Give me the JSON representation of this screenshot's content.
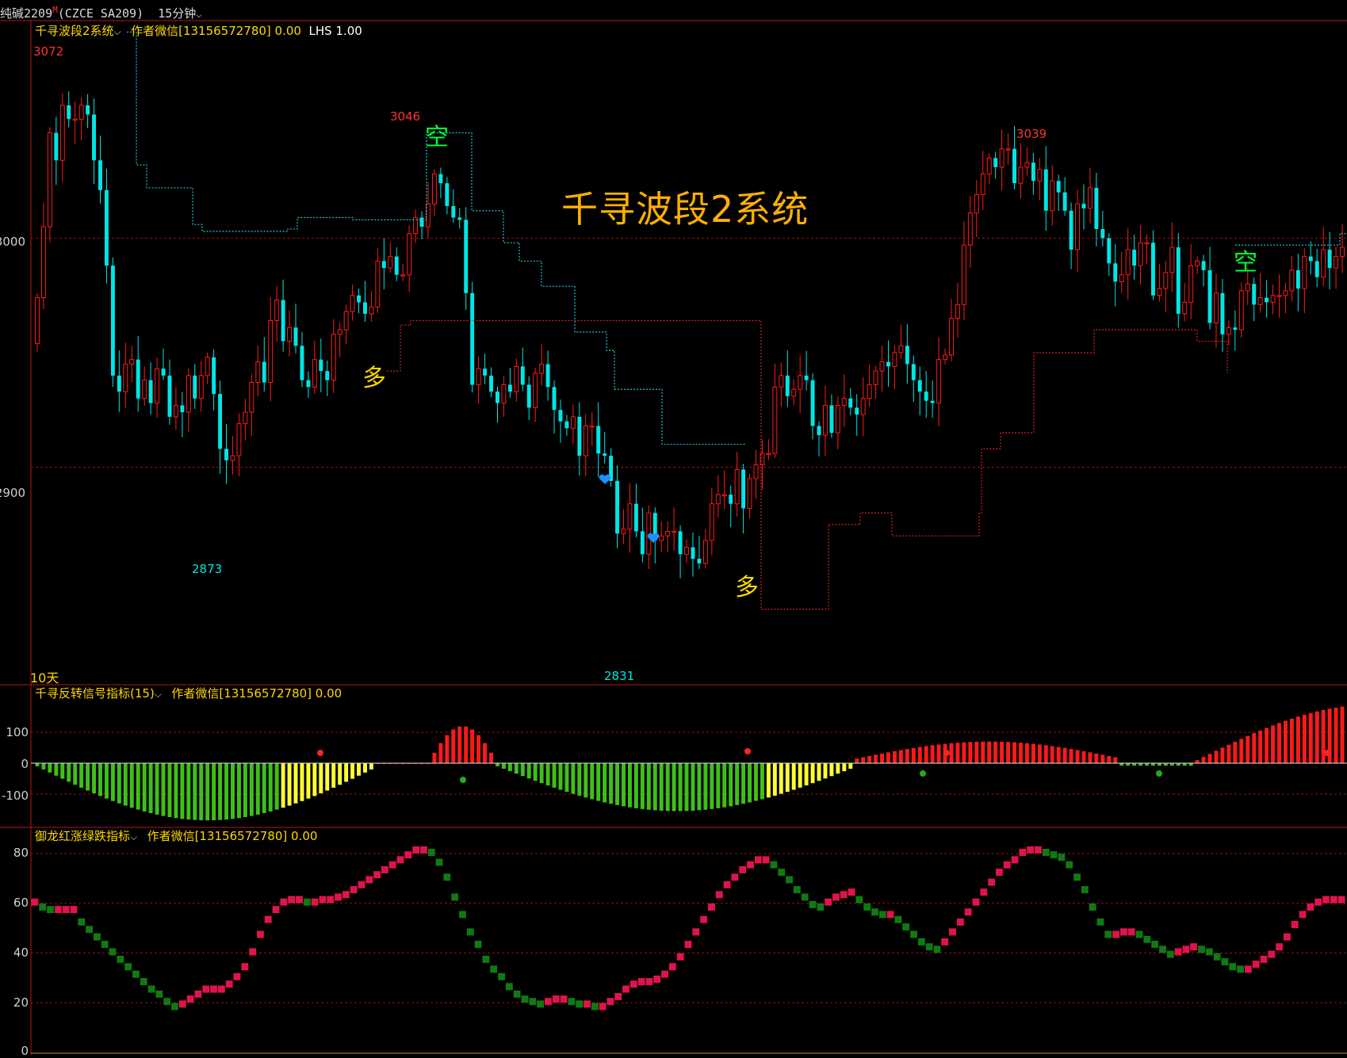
{
  "header": {
    "symbol_name": "纯碱2209",
    "main_marker": "M",
    "symbol_code": "(CZCE SA209)",
    "period": "15分钟"
  },
  "indicator_main": {
    "name": "千寻波段2系统",
    "author": "作者微信[13156572780] 0.00",
    "lhs": "LHS 1.00",
    "watermark": "千寻波段2系统",
    "days_label": "10天",
    "signals": [
      "空",
      "多",
      "多",
      "空"
    ],
    "colors": {
      "up": "#ff1a1a",
      "down": "#00e6e6",
      "title": "#ffb000",
      "short": "#00ff33",
      "long": "#ffd700"
    }
  },
  "indicator_2": {
    "name": "千寻反转信号指标(15)",
    "author": "作者微信[13156572780] 0.00"
  },
  "indicator_3": {
    "name": "御龙红涨绿跌指标",
    "author": "作者微信[13156572780] 0.00"
  },
  "chart_data": [
    {
      "type": "candlestick",
      "panel": "main",
      "yticks": [
        3000,
        2900
      ],
      "ytick_labels": [
        "3000",
        "2900"
      ],
      "ylim": [
        2805,
        3095
      ],
      "price_labels": {
        "high1": "3072",
        "low1": "2873",
        "high2": "3046",
        "low2": "2831",
        "high3": "3039"
      },
      "close": [
        2974,
        3005,
        3046,
        3034,
        3058,
        3052,
        3052,
        3058,
        3054,
        3034,
        3021,
        2988,
        2940,
        2933,
        2945,
        2947,
        2930,
        2938,
        2928,
        2943,
        2940,
        2922,
        2927,
        2924,
        2940,
        2930,
        2940,
        2948,
        2932,
        2908,
        2903,
        2905,
        2919,
        2924,
        2937,
        2946,
        2937,
        2964,
        2973,
        2955,
        2961,
        2953,
        2938,
        2935,
        2947,
        2942,
        2938,
        2958,
        2960,
        2968,
        2975,
        2972,
        2967,
        2970,
        2990,
        2987,
        2992,
        2984,
        2984,
        3002,
        3009,
        3005,
        3015,
        3028,
        3024,
        3014,
        3009,
        3008,
        2976,
        2936,
        2943,
        2940,
        2933,
        2928,
        2936,
        2933,
        2944,
        2936,
        2926,
        2941,
        2945,
        2935,
        2925,
        2920,
        2917,
        2922,
        2905,
        2918,
        2918,
        2906,
        2905,
        2894,
        2871,
        2873,
        2884,
        2872,
        2862,
        2880,
        2868,
        2870,
        2872,
        2872,
        2862,
        2865,
        2860,
        2858,
        2868,
        2884,
        2888,
        2888,
        2884,
        2899,
        2882,
        2895,
        2901,
        2906,
        2906,
        2935,
        2940,
        2931,
        2934,
        2940,
        2938,
        2918,
        2914,
        2927,
        2915,
        2927,
        2930,
        2926,
        2923,
        2930,
        2936,
        2942,
        2946,
        2944,
        2950,
        2953,
        2945,
        2938,
        2933,
        2929,
        2928,
        2947,
        2949,
        2965,
        2971,
        2997,
        3011,
        3019,
        3028,
        3035,
        3031,
        3039,
        3039,
        3024,
        3031,
        3033,
        3025,
        3030,
        3012,
        3025,
        3020,
        3012,
        2995,
        3015,
        3013,
        3022,
        3004,
        3000,
        2989,
        2981,
        2984,
        2995,
        2988,
        2998,
        2998,
        2975,
        2978,
        2985,
        2996,
        2967,
        2972,
        2988,
        2990,
        2986,
        2963,
        2976,
        2958,
        2961,
        2960,
        2977,
        2980,
        2971,
        2974,
        2972,
        2975,
        2975,
        2977,
        2986,
        2978,
        2992,
        2990,
        2983,
        2995,
        2987,
        2992,
        2996
      ],
      "annotation": "dotted stop lines: cyan (short) stepping down from 3050 to 2920, red (long) stepping up from 2870 to 2990"
    },
    {
      "type": "bar",
      "panel": "reversal",
      "yticks": [
        100,
        0,
        -100
      ],
      "ytick_labels": [
        "100",
        "0",
        "-100"
      ],
      "ylim": [
        -180,
        200
      ]
    },
    {
      "type": "line",
      "panel": "trend",
      "yticks": [
        80,
        60,
        40,
        20,
        0
      ],
      "ytick_labels": [
        "80",
        "60",
        "40",
        "20",
        "0"
      ],
      "ylim": [
        0,
        90
      ],
      "values": [
        60,
        58,
        57,
        57,
        57,
        57,
        52,
        49,
        46,
        43,
        40,
        37,
        34,
        31,
        28,
        25,
        23,
        20,
        18,
        19,
        21,
        23,
        25,
        25,
        25,
        27,
        30,
        34,
        40,
        47,
        53,
        57,
        60,
        61,
        61,
        60,
        60,
        61,
        61,
        62,
        63,
        65,
        67,
        69,
        71,
        73,
        75,
        77,
        79,
        81,
        81,
        80,
        76,
        70,
        62,
        55,
        48,
        43,
        37,
        33,
        30,
        26,
        23,
        21,
        20,
        19,
        20,
        21,
        21,
        20,
        19,
        19,
        18,
        18,
        20,
        22,
        25,
        27,
        28,
        28,
        29,
        31,
        34,
        38,
        43,
        48,
        53,
        58,
        63,
        67,
        70,
        73,
        75,
        77,
        77,
        75,
        72,
        69,
        65,
        62,
        59,
        58,
        60,
        62,
        63,
        64,
        61,
        58,
        56,
        55,
        55,
        53,
        50,
        47,
        44,
        42,
        41,
        44,
        48,
        52,
        56,
        60,
        64,
        68,
        72,
        75,
        77,
        80,
        81,
        81,
        80,
        79,
        78,
        75,
        70,
        65,
        58,
        52,
        47,
        47,
        48,
        48,
        47,
        45,
        43,
        41,
        39,
        40,
        41,
        42,
        41,
        40,
        38,
        36,
        34,
        33,
        33,
        35,
        37,
        39,
        42,
        46,
        51,
        55,
        58,
        60,
        61,
        61,
        61
      ]
    }
  ]
}
